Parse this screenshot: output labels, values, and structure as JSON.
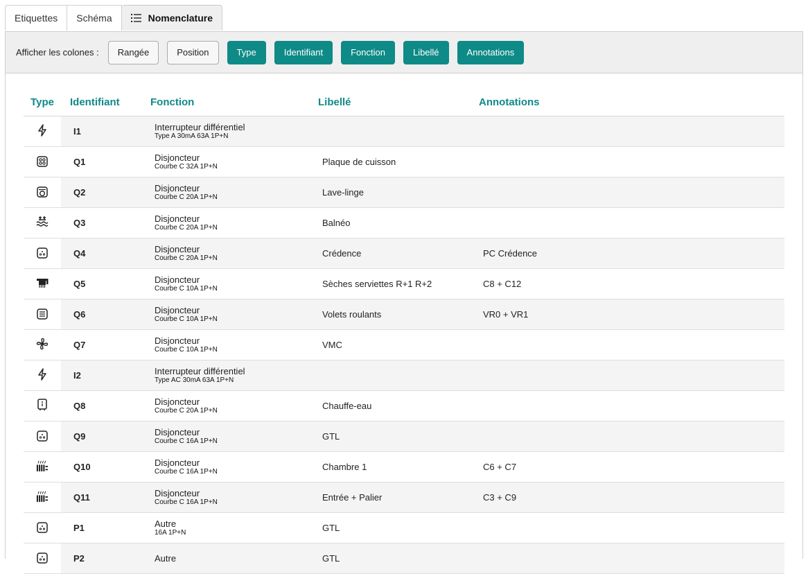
{
  "tabs": [
    {
      "label": "Etiquettes",
      "active": false
    },
    {
      "label": "Schéma",
      "active": false
    },
    {
      "label": "Nomenclature",
      "active": true,
      "icon": "list-icon"
    }
  ],
  "toolbar": {
    "label": "Afficher les colones :",
    "buttons": [
      {
        "label": "Rangée",
        "active": false
      },
      {
        "label": "Position",
        "active": false
      },
      {
        "label": "Type",
        "active": true
      },
      {
        "label": "Identifiant",
        "active": true
      },
      {
        "label": "Fonction",
        "active": true
      },
      {
        "label": "Libellé",
        "active": true
      },
      {
        "label": "Annotations",
        "active": true
      }
    ]
  },
  "accent_color": "#0e8a87",
  "table": {
    "headers": {
      "type": "Type",
      "id": "Identifiant",
      "fonction": "Fonction",
      "libelle": "Libellé",
      "annotations": "Annotations"
    },
    "rows": [
      {
        "icon": "lightning-icon",
        "id": "I1",
        "fn": "Interrupteur différentiel",
        "fn_sub": "Type A 30mA 63A 1P+N",
        "libelle": "",
        "annotation": ""
      },
      {
        "icon": "cooktop-icon",
        "id": "Q1",
        "fn": "Disjoncteur",
        "fn_sub": "Courbe C 32A 1P+N",
        "libelle": "Plaque de cuisson",
        "annotation": ""
      },
      {
        "icon": "washing-machine-icon",
        "id": "Q2",
        "fn": "Disjoncteur",
        "fn_sub": "Courbe C 20A 1P+N",
        "libelle": "Lave-linge",
        "annotation": ""
      },
      {
        "icon": "hot-tub-icon",
        "id": "Q3",
        "fn": "Disjoncteur",
        "fn_sub": "Courbe C 20A 1P+N",
        "libelle": "Balnéo",
        "annotation": ""
      },
      {
        "icon": "socket-icon",
        "id": "Q4",
        "fn": "Disjoncteur",
        "fn_sub": "Courbe C 20A 1P+N",
        "libelle": "Crédence",
        "annotation": "PC Crédence"
      },
      {
        "icon": "towel-dryer-icon",
        "id": "Q5",
        "fn": "Disjoncteur",
        "fn_sub": "Courbe C 10A 1P+N",
        "libelle": "Sèches serviettes R+1 R+2",
        "annotation": "C8 + C12"
      },
      {
        "icon": "shutter-icon",
        "id": "Q6",
        "fn": "Disjoncteur",
        "fn_sub": "Courbe C 10A 1P+N",
        "libelle": "Volets roulants",
        "annotation": "VR0 + VR1"
      },
      {
        "icon": "fan-icon",
        "id": "Q7",
        "fn": "Disjoncteur",
        "fn_sub": "Courbe C 10A 1P+N",
        "libelle": "VMC",
        "annotation": ""
      },
      {
        "icon": "lightning-icon",
        "id": "I2",
        "fn": "Interrupteur différentiel",
        "fn_sub": "Type AC 30mA 63A 1P+N",
        "libelle": "",
        "annotation": ""
      },
      {
        "icon": "water-heater-icon",
        "id": "Q8",
        "fn": "Disjoncteur",
        "fn_sub": "Courbe C 20A 1P+N",
        "libelle": "Chauffe-eau",
        "annotation": ""
      },
      {
        "icon": "socket-icon",
        "id": "Q9",
        "fn": "Disjoncteur",
        "fn_sub": "Courbe C 16A 1P+N",
        "libelle": "GTL",
        "annotation": ""
      },
      {
        "icon": "radiator-icon",
        "id": "Q10",
        "fn": "Disjoncteur",
        "fn_sub": "Courbe C 16A 1P+N",
        "libelle": "Chambre 1",
        "annotation": "C6 + C7"
      },
      {
        "icon": "radiator-icon",
        "id": "Q11",
        "fn": "Disjoncteur",
        "fn_sub": "Courbe C 16A 1P+N",
        "libelle": "Entrée + Palier",
        "annotation": "C3 + C9"
      },
      {
        "icon": "socket-icon",
        "id": "P1",
        "fn": "Autre",
        "fn_sub": "16A 1P+N",
        "libelle": "GTL",
        "annotation": ""
      },
      {
        "icon": "socket-icon",
        "id": "P2",
        "fn": "Autre",
        "fn_sub": "",
        "libelle": "GTL",
        "annotation": ""
      }
    ]
  }
}
